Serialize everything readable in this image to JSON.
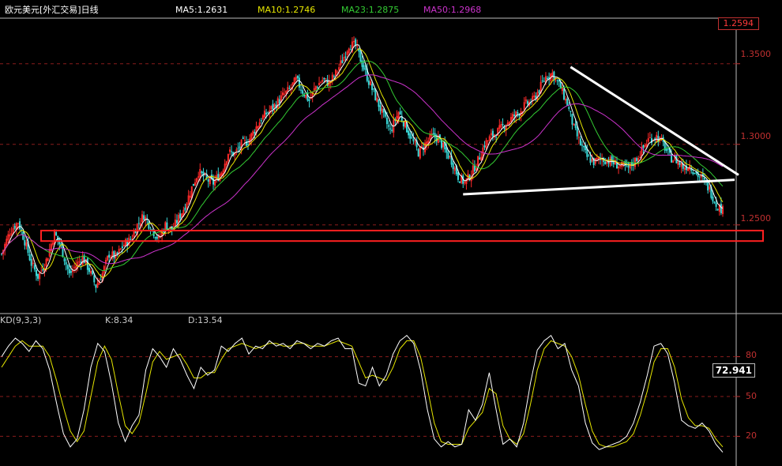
{
  "header": {
    "title": "欧元美元[外汇交易]日线",
    "ma5": "MA5:1.2631",
    "ma10": "MA10:1.2746",
    "ma23": "MA23:1.2875",
    "ma50": "MA50:1.2968"
  },
  "kd_header": {
    "name": "KD(9,3,3)",
    "k": "K:8.34",
    "d": "D:13.54"
  },
  "last_price": "1.2594",
  "kd_value": "72.941",
  "colors": {
    "up": "#ff2a2a",
    "down": "#39d8d8",
    "ma5": "#ffffff",
    "ma10": "#e6e600",
    "ma23": "#33cc33",
    "ma50": "#cc33cc",
    "k": "#ffffff",
    "d": "#e6e600",
    "grid": "#8a1c1c",
    "axis": "#c03030"
  },
  "chart_data": [
    {
      "type": "line",
      "title": "欧元美元[外汇交易]日线",
      "y_tick_labels": [
        "1.3500",
        "1.3000",
        "1.2500"
      ],
      "ylim": [
        1.195,
        1.3778
      ],
      "series": [
        {
          "name": "MA5",
          "last": 1.2631
        },
        {
          "name": "MA10",
          "last": 1.2746
        },
        {
          "name": "MA23",
          "last": 1.2875
        },
        {
          "name": "MA50",
          "last": 1.2968
        }
      ],
      "close_path": [
        [
          0,
          1.232
        ],
        [
          5,
          1.246
        ],
        [
          10,
          1.252
        ],
        [
          14,
          1.24
        ],
        [
          18,
          1.226
        ],
        [
          22,
          1.218
        ],
        [
          27,
          1.228
        ],
        [
          32,
          1.245
        ],
        [
          36,
          1.236
        ],
        [
          41,
          1.219
        ],
        [
          45,
          1.225
        ],
        [
          49,
          1.23
        ],
        [
          53,
          1.222
        ],
        [
          57,
          1.212
        ],
        [
          61,
          1.22
        ],
        [
          65,
          1.232
        ],
        [
          69,
          1.23
        ],
        [
          74,
          1.238
        ],
        [
          78,
          1.241
        ],
        [
          82,
          1.25
        ],
        [
          86,
          1.256
        ],
        [
          91,
          1.247
        ],
        [
          95,
          1.241
        ],
        [
          99,
          1.25
        ],
        [
          103,
          1.247
        ],
        [
          107,
          1.254
        ],
        [
          111,
          1.262
        ],
        [
          115,
          1.273
        ],
        [
          119,
          1.283
        ],
        [
          124,
          1.278
        ],
        [
          128,
          1.276
        ],
        [
          133,
          1.283
        ],
        [
          137,
          1.295
        ],
        [
          141,
          1.294
        ],
        [
          145,
          1.3
        ],
        [
          149,
          1.302
        ],
        [
          153,
          1.309
        ],
        [
          157,
          1.316
        ],
        [
          161,
          1.32
        ],
        [
          165,
          1.324
        ],
        [
          170,
          1.33
        ],
        [
          174,
          1.334
        ],
        [
          178,
          1.34
        ],
        [
          182,
          1.333
        ],
        [
          186,
          1.327
        ],
        [
          190,
          1.336
        ],
        [
          194,
          1.34
        ],
        [
          198,
          1.338
        ],
        [
          202,
          1.344
        ],
        [
          206,
          1.352
        ],
        [
          210,
          1.362
        ],
        [
          214,
          1.361
        ],
        [
          218,
          1.35
        ],
        [
          222,
          1.339
        ],
        [
          227,
          1.327
        ],
        [
          231,
          1.317
        ],
        [
          235,
          1.308
        ],
        [
          240,
          1.32
        ],
        [
          244,
          1.312
        ],
        [
          248,
          1.303
        ],
        [
          252,
          1.295
        ],
        [
          256,
          1.3
        ],
        [
          260,
          1.305
        ],
        [
          264,
          1.304
        ],
        [
          268,
          1.296
        ],
        [
          272,
          1.29
        ],
        [
          276,
          1.28
        ],
        [
          280,
          1.276
        ],
        [
          284,
          1.282
        ],
        [
          288,
          1.29
        ],
        [
          292,
          1.3
        ],
        [
          296,
          1.305
        ],
        [
          300,
          1.308
        ],
        [
          305,
          1.313
        ],
        [
          309,
          1.317
        ],
        [
          313,
          1.32
        ],
        [
          317,
          1.325
        ],
        [
          321,
          1.327
        ],
        [
          325,
          1.334
        ],
        [
          329,
          1.342
        ],
        [
          333,
          1.344
        ],
        [
          338,
          1.335
        ],
        [
          342,
          1.325
        ],
        [
          346,
          1.31
        ],
        [
          350,
          1.3
        ],
        [
          354,
          1.292
        ],
        [
          358,
          1.289
        ],
        [
          362,
          1.291
        ],
        [
          367,
          1.29
        ],
        [
          371,
          1.288
        ],
        [
          375,
          1.286
        ],
        [
          379,
          1.285
        ],
        [
          383,
          1.29
        ],
        [
          387,
          1.296
        ],
        [
          391,
          1.303
        ],
        [
          396,
          1.305
        ],
        [
          400,
          1.3
        ],
        [
          404,
          1.292
        ],
        [
          408,
          1.29
        ],
        [
          412,
          1.286
        ],
        [
          416,
          1.287
        ],
        [
          420,
          1.282
        ],
        [
          424,
          1.278
        ],
        [
          428,
          1.272
        ],
        [
          432,
          1.263
        ],
        [
          436,
          1.259
        ]
      ],
      "annotations": [
        "descending-trendline",
        "horizontal-support-line",
        "support-zone-rectangle"
      ]
    },
    {
      "type": "line",
      "title": "KD(9,3,3)",
      "y_tick_labels": [
        "80",
        "50",
        "20"
      ],
      "ylim": [
        0,
        100
      ],
      "series": [
        {
          "name": "K",
          "last": 8.34
        },
        {
          "name": "D",
          "last": 13.54
        }
      ],
      "k_path": [
        [
          0,
          80
        ],
        [
          4,
          88
        ],
        [
          8,
          94
        ],
        [
          12,
          90
        ],
        [
          16,
          84
        ],
        [
          20,
          92
        ],
        [
          24,
          86
        ],
        [
          28,
          70
        ],
        [
          32,
          45
        ],
        [
          36,
          22
        ],
        [
          40,
          12
        ],
        [
          44,
          18
        ],
        [
          48,
          40
        ],
        [
          52,
          72
        ],
        [
          56,
          90
        ],
        [
          60,
          84
        ],
        [
          64,
          60
        ],
        [
          68,
          30
        ],
        [
          72,
          16
        ],
        [
          76,
          28
        ],
        [
          80,
          36
        ],
        [
          84,
          70
        ],
        [
          88,
          86
        ],
        [
          92,
          80
        ],
        [
          96,
          72
        ],
        [
          100,
          86
        ],
        [
          104,
          78
        ],
        [
          108,
          66
        ],
        [
          112,
          56
        ],
        [
          116,
          72
        ],
        [
          120,
          66
        ],
        [
          124,
          70
        ],
        [
          128,
          88
        ],
        [
          132,
          84
        ],
        [
          136,
          90
        ],
        [
          140,
          94
        ],
        [
          144,
          82
        ],
        [
          148,
          88
        ],
        [
          152,
          86
        ],
        [
          156,
          92
        ],
        [
          160,
          88
        ],
        [
          164,
          90
        ],
        [
          168,
          86
        ],
        [
          172,
          92
        ],
        [
          176,
          90
        ],
        [
          180,
          86
        ],
        [
          184,
          90
        ],
        [
          188,
          88
        ],
        [
          192,
          92
        ],
        [
          196,
          94
        ],
        [
          200,
          86
        ],
        [
          204,
          86
        ],
        [
          208,
          60
        ],
        [
          212,
          58
        ],
        [
          216,
          72
        ],
        [
          220,
          58
        ],
        [
          224,
          66
        ],
        [
          228,
          82
        ],
        [
          232,
          92
        ],
        [
          236,
          96
        ],
        [
          240,
          90
        ],
        [
          244,
          70
        ],
        [
          248,
          40
        ],
        [
          252,
          18
        ],
        [
          256,
          12
        ],
        [
          260,
          16
        ],
        [
          264,
          12
        ],
        [
          268,
          14
        ],
        [
          272,
          40
        ],
        [
          276,
          32
        ],
        [
          280,
          44
        ],
        [
          284,
          68
        ],
        [
          288,
          40
        ],
        [
          292,
          14
        ],
        [
          296,
          18
        ],
        [
          300,
          12
        ],
        [
          304,
          30
        ],
        [
          308,
          60
        ],
        [
          312,
          85
        ],
        [
          316,
          92
        ],
        [
          320,
          96
        ],
        [
          324,
          86
        ],
        [
          328,
          90
        ],
        [
          332,
          70
        ],
        [
          336,
          58
        ],
        [
          340,
          30
        ],
        [
          344,
          15
        ],
        [
          348,
          10
        ],
        [
          352,
          12
        ],
        [
          356,
          14
        ],
        [
          360,
          16
        ],
        [
          364,
          20
        ],
        [
          368,
          30
        ],
        [
          372,
          46
        ],
        [
          376,
          66
        ],
        [
          380,
          88
        ],
        [
          384,
          90
        ],
        [
          388,
          82
        ],
        [
          392,
          60
        ],
        [
          396,
          32
        ],
        [
          400,
          28
        ],
        [
          404,
          26
        ],
        [
          408,
          30
        ],
        [
          412,
          24
        ],
        [
          416,
          14
        ],
        [
          420,
          8
        ]
      ],
      "d_path": [
        [
          0,
          72
        ],
        [
          4,
          80
        ],
        [
          8,
          88
        ],
        [
          12,
          92
        ],
        [
          16,
          88
        ],
        [
          20,
          88
        ],
        [
          24,
          88
        ],
        [
          28,
          80
        ],
        [
          32,
          62
        ],
        [
          36,
          42
        ],
        [
          40,
          24
        ],
        [
          44,
          16
        ],
        [
          48,
          24
        ],
        [
          52,
          50
        ],
        [
          56,
          76
        ],
        [
          60,
          88
        ],
        [
          64,
          78
        ],
        [
          68,
          52
        ],
        [
          72,
          28
        ],
        [
          76,
          22
        ],
        [
          80,
          30
        ],
        [
          84,
          52
        ],
        [
          88,
          76
        ],
        [
          92,
          84
        ],
        [
          96,
          78
        ],
        [
          100,
          80
        ],
        [
          104,
          82
        ],
        [
          108,
          74
        ],
        [
          112,
          64
        ],
        [
          116,
          64
        ],
        [
          120,
          68
        ],
        [
          124,
          68
        ],
        [
          128,
          78
        ],
        [
          132,
          86
        ],
        [
          136,
          88
        ],
        [
          140,
          90
        ],
        [
          144,
          88
        ],
        [
          148,
          86
        ],
        [
          152,
          88
        ],
        [
          156,
          90
        ],
        [
          160,
          90
        ],
        [
          164,
          88
        ],
        [
          168,
          88
        ],
        [
          172,
          90
        ],
        [
          176,
          90
        ],
        [
          180,
          88
        ],
        [
          184,
          88
        ],
        [
          188,
          88
        ],
        [
          192,
          90
        ],
        [
          196,
          92
        ],
        [
          200,
          90
        ],
        [
          204,
          88
        ],
        [
          208,
          76
        ],
        [
          212,
          64
        ],
        [
          216,
          66
        ],
        [
          220,
          64
        ],
        [
          224,
          62
        ],
        [
          228,
          72
        ],
        [
          232,
          86
        ],
        [
          236,
          92
        ],
        [
          240,
          92
        ],
        [
          244,
          80
        ],
        [
          248,
          56
        ],
        [
          252,
          30
        ],
        [
          256,
          16
        ],
        [
          260,
          14
        ],
        [
          264,
          14
        ],
        [
          268,
          14
        ],
        [
          272,
          26
        ],
        [
          276,
          32
        ],
        [
          280,
          38
        ],
        [
          284,
          56
        ],
        [
          288,
          52
        ],
        [
          292,
          28
        ],
        [
          296,
          18
        ],
        [
          300,
          14
        ],
        [
          304,
          22
        ],
        [
          308,
          44
        ],
        [
          312,
          70
        ],
        [
          316,
          86
        ],
        [
          320,
          92
        ],
        [
          324,
          90
        ],
        [
          328,
          88
        ],
        [
          332,
          80
        ],
        [
          336,
          66
        ],
        [
          340,
          44
        ],
        [
          344,
          24
        ],
        [
          348,
          14
        ],
        [
          352,
          12
        ],
        [
          356,
          12
        ],
        [
          360,
          14
        ],
        [
          364,
          16
        ],
        [
          368,
          22
        ],
        [
          372,
          36
        ],
        [
          376,
          54
        ],
        [
          380,
          76
        ],
        [
          384,
          86
        ],
        [
          388,
          86
        ],
        [
          392,
          72
        ],
        [
          396,
          48
        ],
        [
          400,
          34
        ],
        [
          404,
          28
        ],
        [
          408,
          28
        ],
        [
          412,
          26
        ],
        [
          416,
          18
        ],
        [
          420,
          12
        ]
      ]
    }
  ]
}
